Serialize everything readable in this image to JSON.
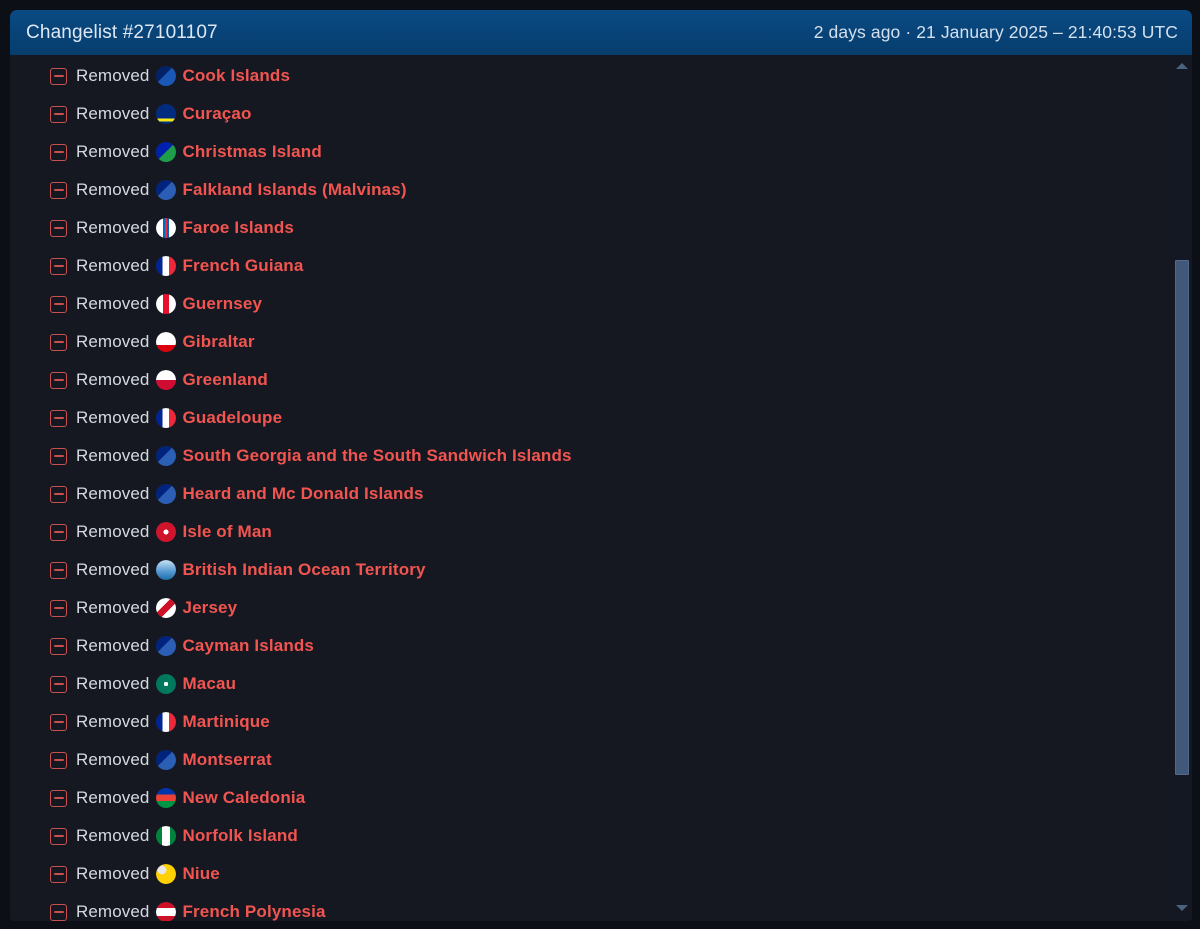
{
  "window": {
    "background_color": "#0c0f16",
    "panel_color": "#151821"
  },
  "header": {
    "title": "Changelist #27101107",
    "meta": "2 days ago · 21 January 2025 – 21:40:53 UTC",
    "background_color": "#08437a",
    "title_color": "#dfe8f2"
  },
  "colors": {
    "removed_label": "#d5dae0",
    "country_name": "#f25550",
    "minus_icon": "#c8514f",
    "scrollbar_thumb": "#42587a"
  },
  "scrollbar": {
    "up_arrow_icon": "triangle-up-icon",
    "down_arrow_icon": "triangle-down-icon",
    "thumb_label": "scrollbar-thumb"
  },
  "list": {
    "action_label": "Removed",
    "minus_icon_name": "minus-square-icon",
    "rows": [
      {
        "action": "Removed",
        "country": "Cook Islands",
        "flag": "🇨🇰",
        "flag_name": "flag-cook-islands"
      },
      {
        "action": "Removed",
        "country": "Curaçao",
        "flag": "🇨🇼",
        "flag_name": "flag-curacao"
      },
      {
        "action": "Removed",
        "country": "Christmas Island",
        "flag": "🇨🇽",
        "flag_name": "flag-christmas-island"
      },
      {
        "action": "Removed",
        "country": "Falkland Islands (Malvinas)",
        "flag": "🇫🇰",
        "flag_name": "flag-falkland-islands"
      },
      {
        "action": "Removed",
        "country": "Faroe Islands",
        "flag": "🇫🇴",
        "flag_name": "flag-faroe-islands"
      },
      {
        "action": "Removed",
        "country": "French Guiana",
        "flag": "🇬🇫",
        "flag_name": "flag-french-guiana"
      },
      {
        "action": "Removed",
        "country": "Guernsey",
        "flag": "🇬🇬",
        "flag_name": "flag-guernsey"
      },
      {
        "action": "Removed",
        "country": "Gibraltar",
        "flag": "🇬🇮",
        "flag_name": "flag-gibraltar"
      },
      {
        "action": "Removed",
        "country": "Greenland",
        "flag": "🇬🇱",
        "flag_name": "flag-greenland"
      },
      {
        "action": "Removed",
        "country": "Guadeloupe",
        "flag": "🇬🇵",
        "flag_name": "flag-guadeloupe"
      },
      {
        "action": "Removed",
        "country": "South Georgia and the South Sandwich Islands",
        "flag": "🇬🇸",
        "flag_name": "flag-south-georgia"
      },
      {
        "action": "Removed",
        "country": "Heard and Mc Donald Islands",
        "flag": "🇭🇲",
        "flag_name": "flag-heard-mcdonald-islands"
      },
      {
        "action": "Removed",
        "country": "Isle of Man",
        "flag": "🇮🇲",
        "flag_name": "flag-isle-of-man"
      },
      {
        "action": "Removed",
        "country": "British Indian Ocean Territory",
        "flag": "🇮🇴",
        "flag_name": "flag-british-indian-ocean-territory"
      },
      {
        "action": "Removed",
        "country": "Jersey",
        "flag": "🇯🇪",
        "flag_name": "flag-jersey"
      },
      {
        "action": "Removed",
        "country": "Cayman Islands",
        "flag": "🇰🇾",
        "flag_name": "flag-cayman-islands"
      },
      {
        "action": "Removed",
        "country": "Macau",
        "flag": "🇲🇴",
        "flag_name": "flag-macau"
      },
      {
        "action": "Removed",
        "country": "Martinique",
        "flag": "🇲🇶",
        "flag_name": "flag-martinique"
      },
      {
        "action": "Removed",
        "country": "Montserrat",
        "flag": "🇲🇸",
        "flag_name": "flag-montserrat"
      },
      {
        "action": "Removed",
        "country": "New Caledonia",
        "flag": "🇳🇨",
        "flag_name": "flag-new-caledonia"
      },
      {
        "action": "Removed",
        "country": "Norfolk Island",
        "flag": "🇳🇫",
        "flag_name": "flag-norfolk-island"
      },
      {
        "action": "Removed",
        "country": "Niue",
        "flag": "🇳🇺",
        "flag_name": "flag-niue"
      },
      {
        "action": "Removed",
        "country": "French Polynesia",
        "flag": "🇵🇫",
        "flag_name": "flag-french-polynesia"
      }
    ]
  }
}
